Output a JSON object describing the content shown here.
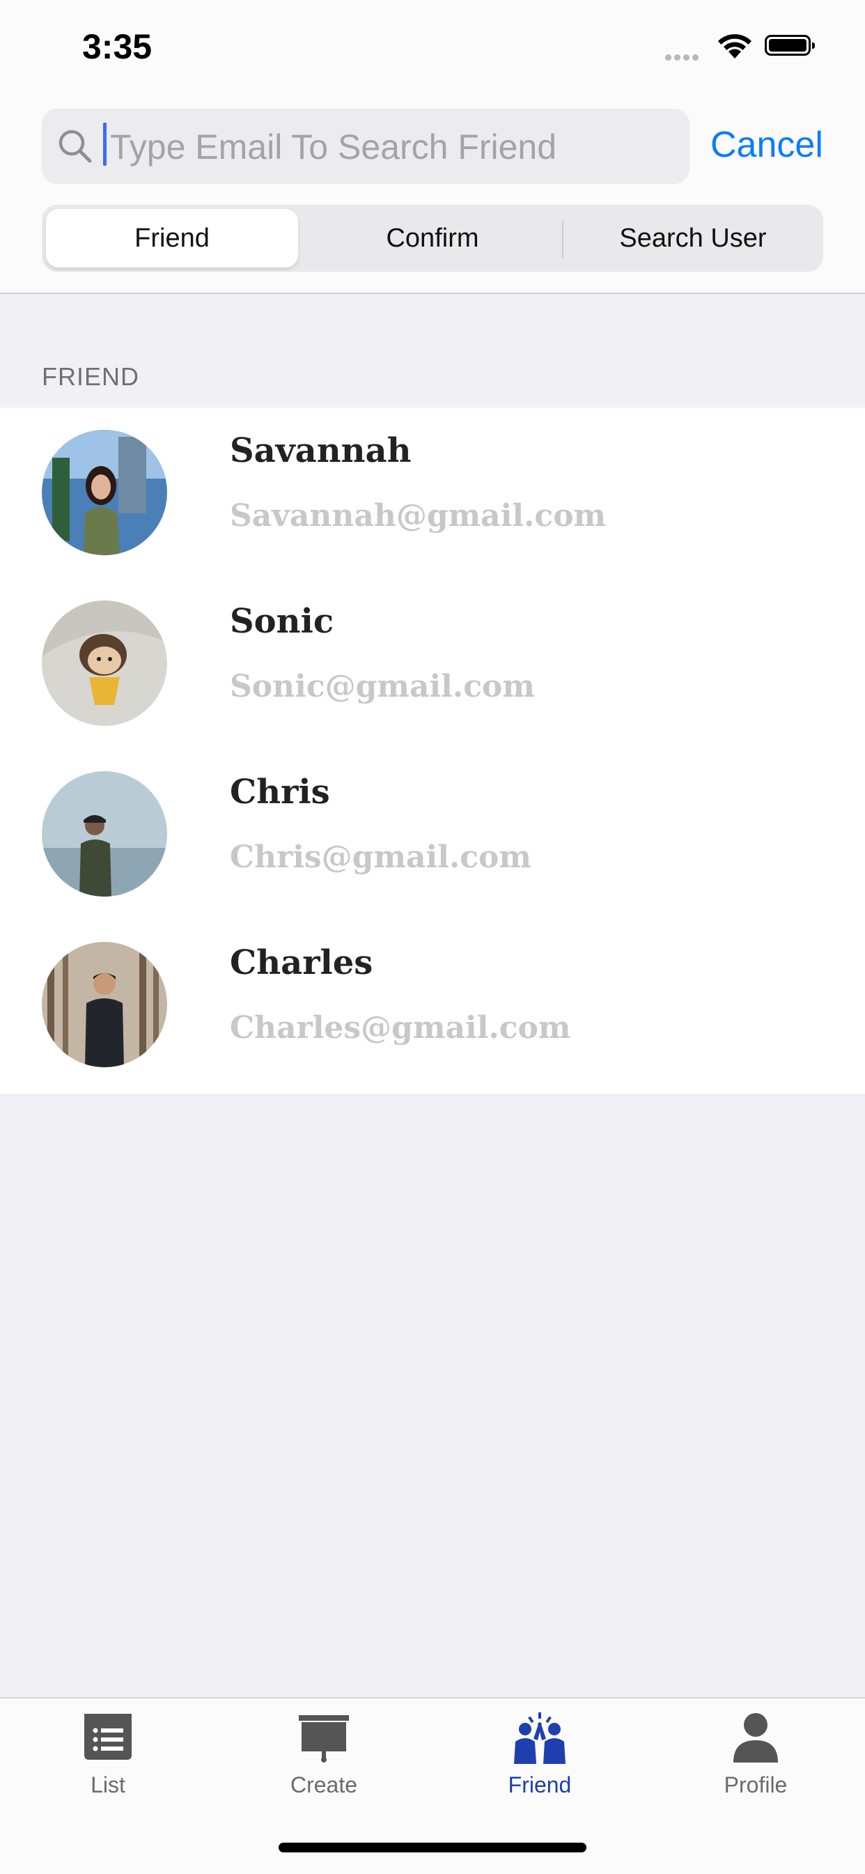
{
  "status_bar": {
    "time": "3:35"
  },
  "search": {
    "placeholder": "Type Email To Search Friend",
    "cancel_label": "Cancel"
  },
  "segments": [
    {
      "label": "Friend",
      "selected": true
    },
    {
      "label": "Confirm",
      "selected": false
    },
    {
      "label": "Search User",
      "selected": false
    }
  ],
  "section": {
    "title": "FRIEND"
  },
  "friends": [
    {
      "name": "Savannah",
      "email": "Savannah@gmail.com"
    },
    {
      "name": "Sonic",
      "email": "Sonic@gmail.com"
    },
    {
      "name": "Chris",
      "email": "Chris@gmail.com"
    },
    {
      "name": "Charles",
      "email": "Charles@gmail.com"
    }
  ],
  "tabs": [
    {
      "label": "List",
      "icon": "list-icon",
      "active": false
    },
    {
      "label": "Create",
      "icon": "create-board-icon",
      "active": false
    },
    {
      "label": "Friend",
      "icon": "friends-icon",
      "active": true
    },
    {
      "label": "Profile",
      "icon": "profile-icon",
      "active": false
    }
  ],
  "colors": {
    "accent": "#0a7cff",
    "active_tab": "#1f3fae",
    "email_text": "#c8c8ca"
  }
}
